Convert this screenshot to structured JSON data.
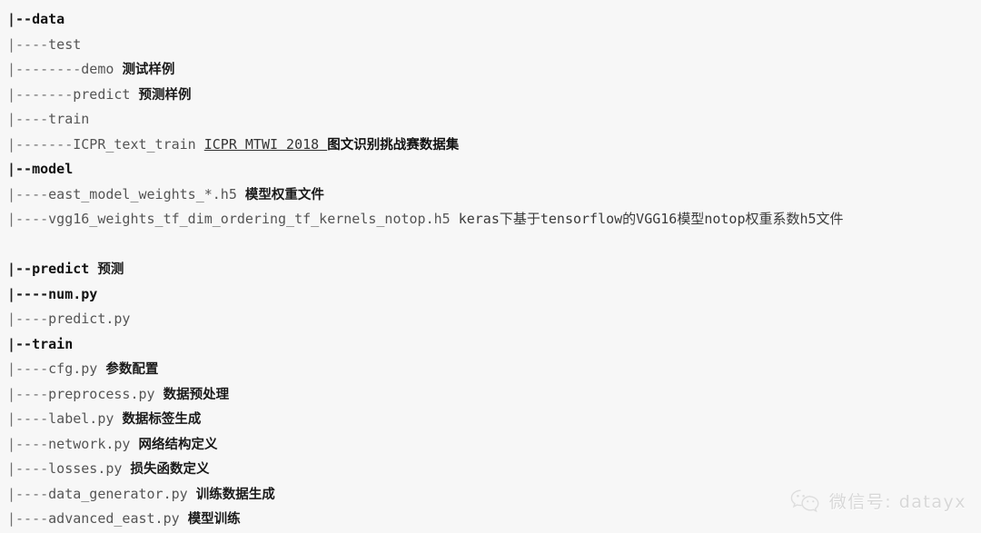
{
  "page": {
    "background_color": "#f7f7f7",
    "text_color": "#555555",
    "bold_color": "#111111",
    "watermark_color": "#d8d8d8"
  },
  "tree": {
    "lines": [
      {
        "prefix": "|--",
        "name": "data",
        "desc": "",
        "bold": true,
        "blank": false,
        "desc_style": "cn"
      },
      {
        "prefix": "|----",
        "name": "test",
        "desc": "",
        "bold": false,
        "blank": false,
        "desc_style": "cn"
      },
      {
        "prefix": "|--------",
        "name": "demo",
        "desc": "测试样例",
        "bold": false,
        "blank": false,
        "desc_style": "cn"
      },
      {
        "prefix": "|-------",
        "name": "predict",
        "desc": "预测样例",
        "bold": false,
        "blank": false,
        "desc_style": "cn"
      },
      {
        "prefix": "|----",
        "name": "train",
        "desc": "",
        "bold": false,
        "blank": false,
        "desc_style": "cn"
      },
      {
        "prefix": "|-------",
        "name": "ICPR_text_train",
        "desc": "ICPR MTWI 2018 ",
        "bold": false,
        "blank": false,
        "desc_style": "link",
        "desc2": "图文识别挑战赛数据集"
      },
      {
        "prefix": "|--",
        "name": "model",
        "desc": "",
        "bold": true,
        "blank": false,
        "desc_style": "cn"
      },
      {
        "prefix": "|----",
        "name": "east_model_weights_*.h5",
        "desc": "模型权重文件",
        "bold": false,
        "blank": false,
        "desc_style": "cn"
      },
      {
        "prefix": "|----",
        "name": "vgg16_weights_tf_dim_ordering_tf_kernels_notop.h5",
        "desc": "keras下基于tensorflow的VGG16模型notop权重系数h5文件",
        "bold": false,
        "blank": false,
        "desc_style": "mono"
      },
      {
        "prefix": "",
        "name": "",
        "desc": "",
        "bold": false,
        "blank": true,
        "desc_style": "cn"
      },
      {
        "prefix": "|--",
        "name": "predict",
        "desc": "预测",
        "bold": true,
        "blank": false,
        "desc_style": "cn"
      },
      {
        "prefix": "|----",
        "name": "num.py",
        "desc": "",
        "bold": true,
        "blank": false,
        "desc_style": "cn"
      },
      {
        "prefix": "|----",
        "name": "predict.py",
        "desc": "",
        "bold": false,
        "blank": false,
        "desc_style": "cn"
      },
      {
        "prefix": "|--",
        "name": "train",
        "desc": "",
        "bold": true,
        "blank": false,
        "desc_style": "cn"
      },
      {
        "prefix": "|----",
        "name": "cfg.py",
        "desc": "参数配置",
        "bold": false,
        "blank": false,
        "desc_style": "cn"
      },
      {
        "prefix": "|----",
        "name": "preprocess.py",
        "desc": "数据预处理",
        "bold": false,
        "blank": false,
        "desc_style": "cn"
      },
      {
        "prefix": "|----",
        "name": "label.py",
        "desc": "数据标签生成",
        "bold": false,
        "blank": false,
        "desc_style": "cn"
      },
      {
        "prefix": "|----",
        "name": "network.py",
        "desc": "网络结构定义",
        "bold": false,
        "blank": false,
        "desc_style": "cn"
      },
      {
        "prefix": "|----",
        "name": "losses.py",
        "desc": "损失函数定义",
        "bold": false,
        "blank": false,
        "desc_style": "cn"
      },
      {
        "prefix": "|----",
        "name": "data_generator.py",
        "desc": "训练数据生成",
        "bold": false,
        "blank": false,
        "desc_style": "cn"
      },
      {
        "prefix": "|----",
        "name": "advanced_east.py",
        "desc": "模型训练",
        "bold": false,
        "blank": false,
        "desc_style": "cn"
      }
    ]
  },
  "watermark": {
    "icon": "wechat-icon",
    "text": "微信号: datayx"
  }
}
